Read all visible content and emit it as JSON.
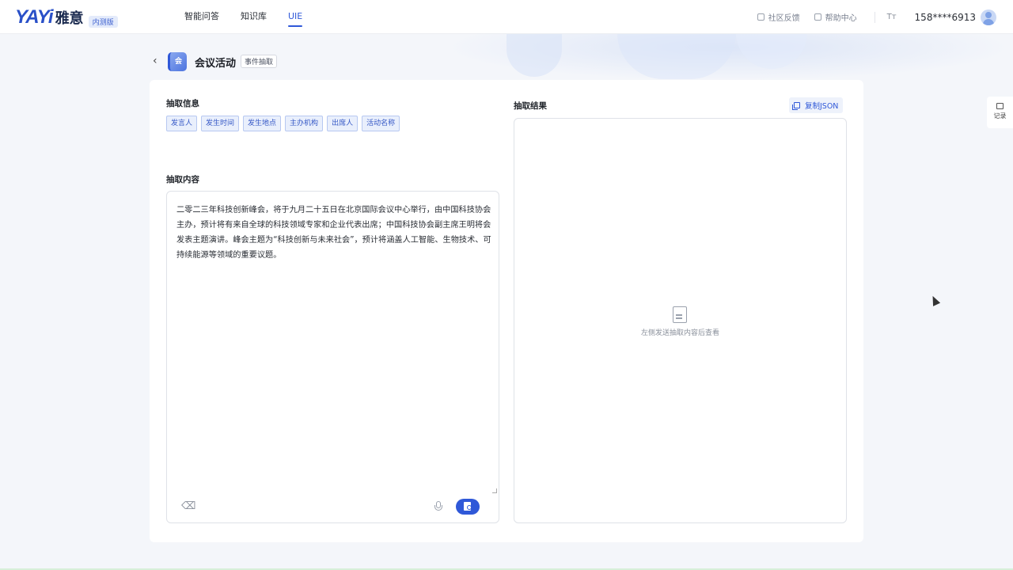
{
  "header": {
    "logo_text": "YAYi",
    "logo_cn": "雅意",
    "logo_badge": "内测版",
    "nav": [
      {
        "label": "智能问答",
        "active": false
      },
      {
        "label": "知识库",
        "active": false
      },
      {
        "label": "UIE",
        "active": true
      }
    ],
    "community_feedback": "社区反馈",
    "help_center": "帮助中心",
    "font_size_icon": "Tт",
    "user_phone": "158****6913"
  },
  "page": {
    "title": "会议活动",
    "title_tag": "事件抽取",
    "app_icon_text": "会"
  },
  "extract_info": {
    "label": "抽取信息",
    "tags": [
      "发言人",
      "发生时间",
      "发生地点",
      "主办机构",
      "出席人",
      "活动名称"
    ]
  },
  "extract_content": {
    "label": "抽取内容",
    "text": "二零二三年科技创新峰会，将于九月二十五日在北京国际会议中心举行，由中国科技协会主办，预计将有来自全球的科技领域专家和企业代表出席；中国科技协会副主席王明将会发表主题演讲。峰会主题为“科技创新与未来社会”，预计将涵盖人工智能、生物技术、可持续能源等领域的重要议题。"
  },
  "extract_result": {
    "label": "抽取结果",
    "copy_button": "复制JSON",
    "empty_text": "左侧发送抽取内容后查看"
  },
  "side": {
    "records_label": "记录"
  },
  "colors": {
    "accent": "#2f58d8",
    "tag_bg": "#e9effc",
    "page_bg": "#f4f6fa"
  }
}
